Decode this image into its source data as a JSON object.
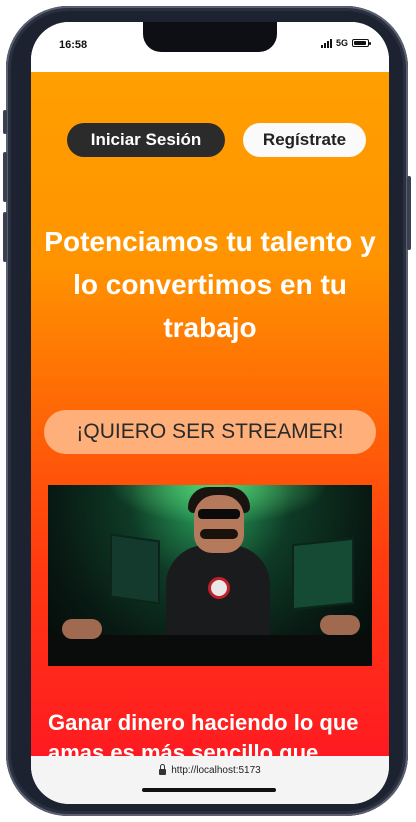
{
  "status_bar": {
    "time": "16:58",
    "network": "5G"
  },
  "header": {
    "login_label": "Iniciar Sesión",
    "register_label": "Regístrate"
  },
  "hero": {
    "title": "Potenciamos tu talento y lo convertimos en tu trabajo",
    "cta_label": "¡QUIERO SER STREAMER!"
  },
  "section": {
    "title": "Ganar dinero haciendo lo que amas es más sencillo que"
  },
  "browser": {
    "url": "http://localhost:5173"
  },
  "colors": {
    "gradient_top": "#ff9f00",
    "gradient_bottom": "#ff1a22",
    "login_button": "#2b2b2b",
    "cta_button": "#ffb07a"
  },
  "icons": [
    "lock-icon",
    "signal-icon",
    "battery-icon"
  ]
}
